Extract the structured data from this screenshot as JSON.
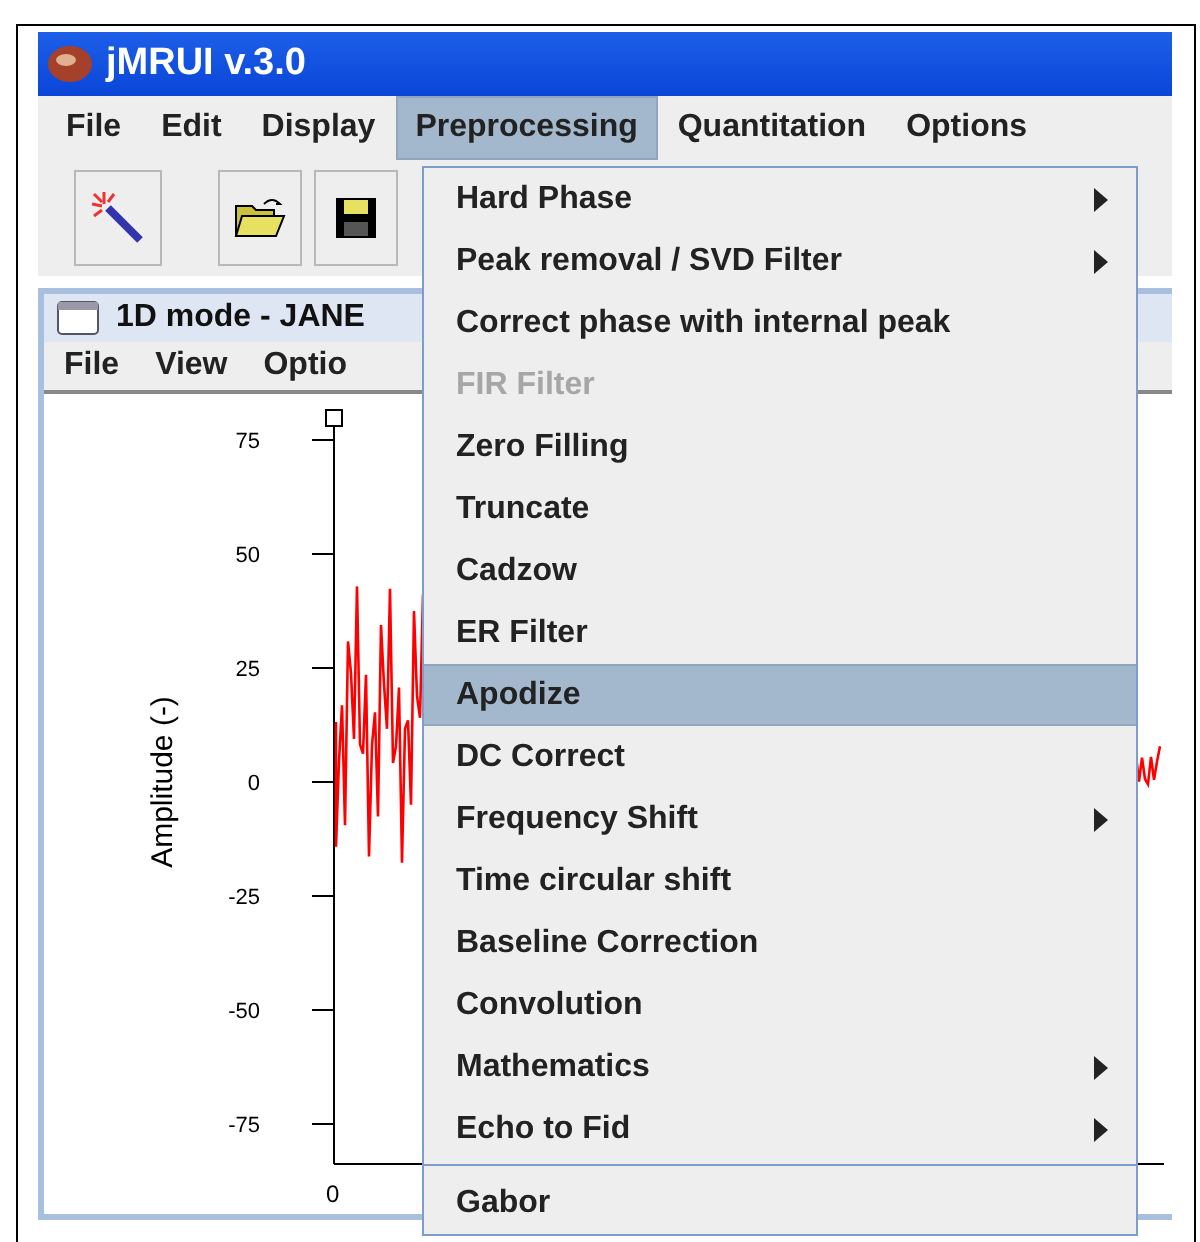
{
  "window": {
    "title": "jMRUI v.3.0"
  },
  "menu_bar": [
    {
      "label": "File",
      "selected": false
    },
    {
      "label": "Edit",
      "selected": false
    },
    {
      "label": "Display",
      "selected": false
    },
    {
      "label": "Preprocessing",
      "selected": true
    },
    {
      "label": "Quantitation",
      "selected": false
    },
    {
      "label": "Options",
      "selected": false
    }
  ],
  "toolbar": [
    {
      "kind": "wand"
    },
    {
      "kind": "open"
    },
    {
      "kind": "save"
    }
  ],
  "inner_window": {
    "title": "1D mode - JANE",
    "menu_bar": [
      {
        "label": "File"
      },
      {
        "label": "View"
      },
      {
        "label": "Optio"
      }
    ],
    "plot": {
      "ylabel": "Amplitude (-)",
      "yticks": [
        "75",
        "50",
        "25",
        "0",
        "-25",
        "-50",
        "-75"
      ],
      "xticks": [
        "0"
      ]
    }
  },
  "dropdown": [
    {
      "kind": "item",
      "label": "Hard Phase",
      "submenu": true,
      "disabled": false,
      "selected": false
    },
    {
      "kind": "item",
      "label": "Peak removal / SVD Filter",
      "submenu": true,
      "disabled": false,
      "selected": false
    },
    {
      "kind": "item",
      "label": "Correct phase with internal peak",
      "submenu": false,
      "disabled": false,
      "selected": false
    },
    {
      "kind": "item",
      "label": "FIR Filter",
      "submenu": false,
      "disabled": true,
      "selected": false
    },
    {
      "kind": "item",
      "label": "Zero Filling",
      "submenu": false,
      "disabled": false,
      "selected": false
    },
    {
      "kind": "item",
      "label": "Truncate",
      "submenu": false,
      "disabled": false,
      "selected": false
    },
    {
      "kind": "item",
      "label": "Cadzow",
      "submenu": false,
      "disabled": false,
      "selected": false
    },
    {
      "kind": "item",
      "label": "ER Filter",
      "submenu": false,
      "disabled": false,
      "selected": false
    },
    {
      "kind": "item",
      "label": "Apodize",
      "submenu": false,
      "disabled": false,
      "selected": true
    },
    {
      "kind": "item",
      "label": "DC Correct",
      "submenu": false,
      "disabled": false,
      "selected": false
    },
    {
      "kind": "item",
      "label": "Frequency Shift",
      "submenu": true,
      "disabled": false,
      "selected": false
    },
    {
      "kind": "item",
      "label": "Time circular shift",
      "submenu": false,
      "disabled": false,
      "selected": false
    },
    {
      "kind": "item",
      "label": "Baseline Correction",
      "submenu": false,
      "disabled": false,
      "selected": false
    },
    {
      "kind": "item",
      "label": "Convolution",
      "submenu": false,
      "disabled": false,
      "selected": false
    },
    {
      "kind": "item",
      "label": "Mathematics",
      "submenu": true,
      "disabled": false,
      "selected": false
    },
    {
      "kind": "item",
      "label": "Echo to Fid",
      "submenu": true,
      "disabled": false,
      "selected": false
    },
    {
      "kind": "separator"
    },
    {
      "kind": "item",
      "label": "Gabor",
      "submenu": false,
      "disabled": false,
      "selected": false
    }
  ]
}
